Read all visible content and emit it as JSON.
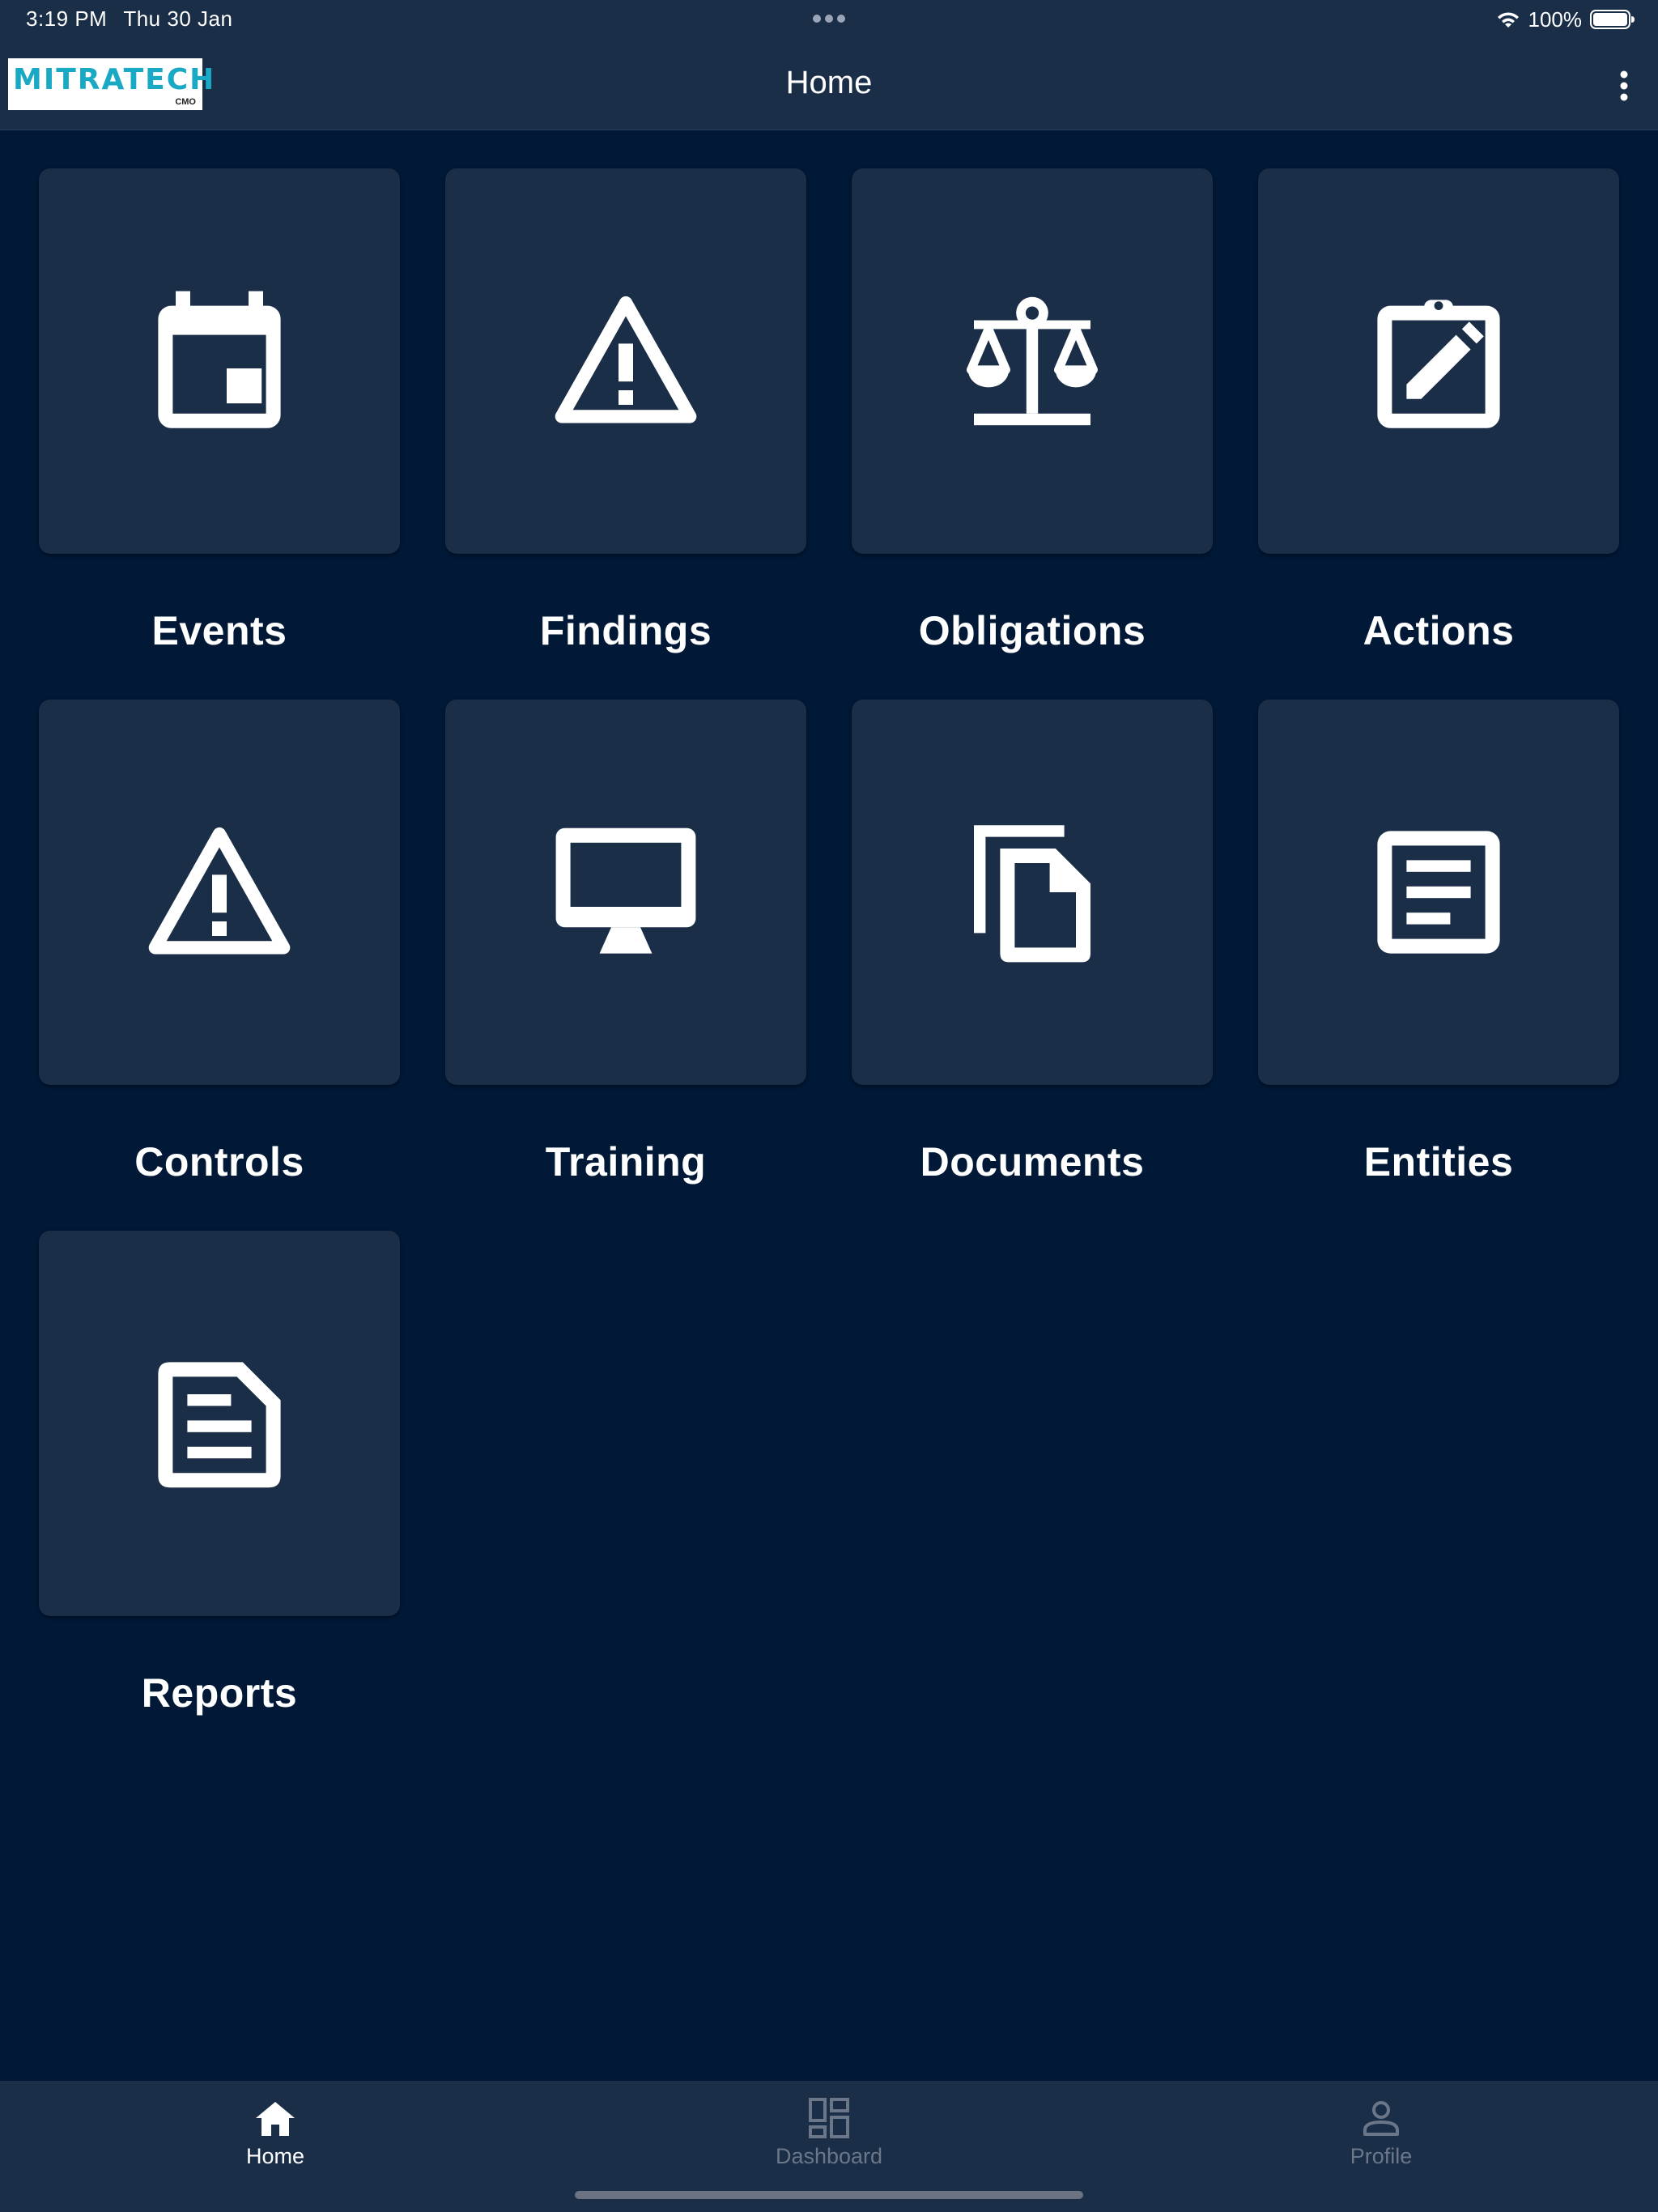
{
  "status_bar": {
    "time": "3:19 PM",
    "date": "Thu 30 Jan",
    "battery": "100%"
  },
  "header": {
    "logo_text": "MITRATECH",
    "logo_sub": "CMO",
    "title": "Home"
  },
  "tiles": [
    {
      "label": "Events",
      "icon": "calendar-icon"
    },
    {
      "label": "Findings",
      "icon": "warning-icon"
    },
    {
      "label": "Obligations",
      "icon": "scale-icon"
    },
    {
      "label": "Actions",
      "icon": "clipboard-edit-icon"
    },
    {
      "label": "Controls",
      "icon": "warning-icon"
    },
    {
      "label": "Training",
      "icon": "monitor-icon"
    },
    {
      "label": "Documents",
      "icon": "copy-documents-icon"
    },
    {
      "label": "Entities",
      "icon": "article-icon"
    },
    {
      "label": "Reports",
      "icon": "report-document-icon"
    }
  ],
  "tab_bar": {
    "items": [
      {
        "label": "Home",
        "icon": "home-icon",
        "active": true
      },
      {
        "label": "Dashboard",
        "icon": "dashboard-icon",
        "active": false
      },
      {
        "label": "Profile",
        "icon": "person-icon",
        "active": false
      }
    ]
  },
  "colors": {
    "background": "#011936",
    "surface": "#1a2e48",
    "logo_accent": "#19a9c4",
    "inactive_tab": "#6b7789"
  }
}
